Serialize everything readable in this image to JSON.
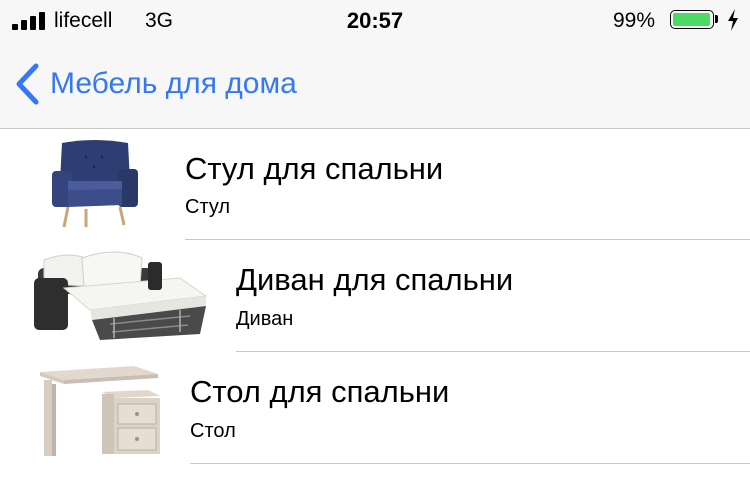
{
  "status_bar": {
    "carrier": "lifecell",
    "network": "3G",
    "time": "20:57",
    "battery_percent": "99%",
    "battery_level": 0.99,
    "battery_color": "#4cd964"
  },
  "nav": {
    "back_label": "Мебель для дома",
    "accent_color": "#3478f6"
  },
  "items": [
    {
      "title": "Стул для спальни",
      "subtitle": "Стул",
      "icon": "armchair-icon"
    },
    {
      "title": "Диван для спальни",
      "subtitle": "Диван",
      "icon": "sofa-bed-icon"
    },
    {
      "title": "Стол для спальни",
      "subtitle": "Стол",
      "icon": "desk-icon"
    }
  ]
}
